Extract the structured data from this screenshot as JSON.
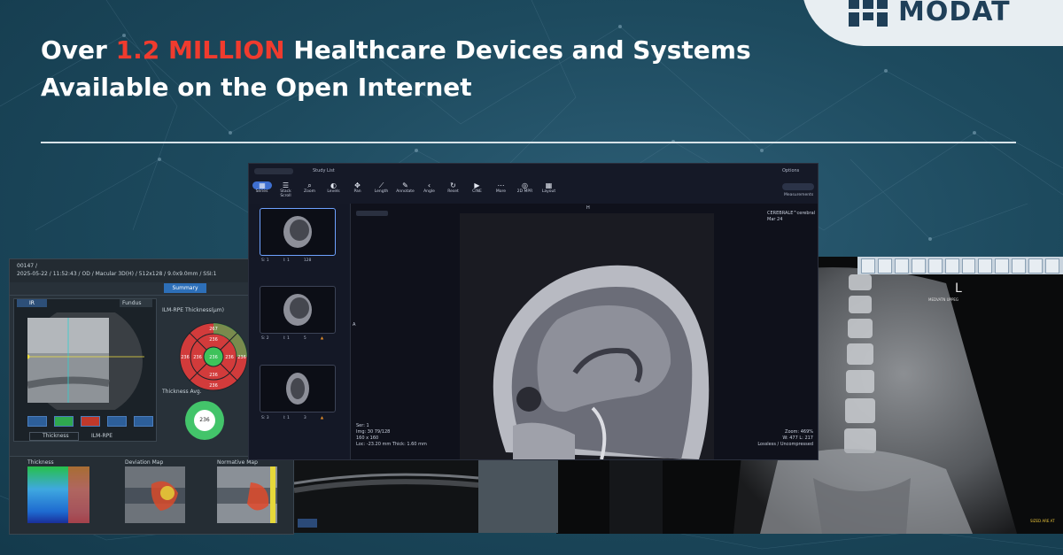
{
  "headline": {
    "prefix": "Over ",
    "highlight": "1.2 MILLION",
    "suffix": " Healthcare Devices and Systems Available on the Open Internet"
  },
  "brand": {
    "name": "MODAT"
  },
  "colors": {
    "highlight": "#f03b2e",
    "background": "#1d4a5e",
    "logo": "#1f3f58"
  },
  "oct_viewer": {
    "patient_id": "00147 /",
    "scan_info": "2025-05-22 / 11:52:43 / OD / Macular 3D(H) / 512x128 / 9.0x9.0mm / SSI:1",
    "tab_summary": "Summary",
    "mode_button": "IR",
    "fundus_select": "Fundus",
    "thickness_title": "ILM-RPE Thickness(μm)",
    "grid_values": [
      "267",
      "236",
      "236",
      "236",
      "236",
      "236",
      "236",
      "236",
      "236"
    ],
    "thickness_avg_label": "Thickness Avg.",
    "thickness_avg_value": "236",
    "layer_left": "Thickness",
    "layer_right": "ILM-RPE",
    "maps": [
      "Thickness",
      "Deviation Map",
      "Normative Map"
    ]
  },
  "dicom_viewer": {
    "study_list": "Study List",
    "options": "Options",
    "tools": [
      "Series",
      "Stack Scroll",
      "Zoom",
      "Levels",
      "Pan",
      "Length",
      "Annotate",
      "Angle",
      "Reset",
      "CINE",
      "More",
      "2D MPR",
      "Layout"
    ],
    "tool_icons": [
      "grid-icon",
      "menu-icon",
      "zoom-icon",
      "contrast-icon",
      "pan-icon",
      "ruler-icon",
      "pen-icon",
      "angle-icon",
      "reset-icon",
      "play-icon",
      "more-icon",
      "cube-icon",
      "layout-icon"
    ],
    "measurements": "Measurements",
    "orientation_top": "H",
    "orientation_left": "A",
    "institution": "CEREBRALE^cerebral",
    "date": "Mar 24",
    "info_left": [
      "Ser: 1",
      "Img: 30 79/128",
      "160 x 160",
      "Loc: -23.20 mm Thick: 1.60 mm"
    ],
    "info_right": [
      "Zoom: 469%",
      "W: 477 L: 217",
      "Lossless / Uncompressed"
    ],
    "thumbnails": [
      {
        "series": "S: 1",
        "instance": "I: 1",
        "count": "128"
      },
      {
        "series": "S: 2",
        "instance": "I: 1",
        "count": "5"
      },
      {
        "series": "S: 3",
        "instance": "I: 1",
        "count": "3"
      }
    ]
  },
  "xray_viewer": {
    "marker": "L",
    "label": "SIZED ARE AT",
    "header_text": "MEDVATN UPPEG"
  }
}
